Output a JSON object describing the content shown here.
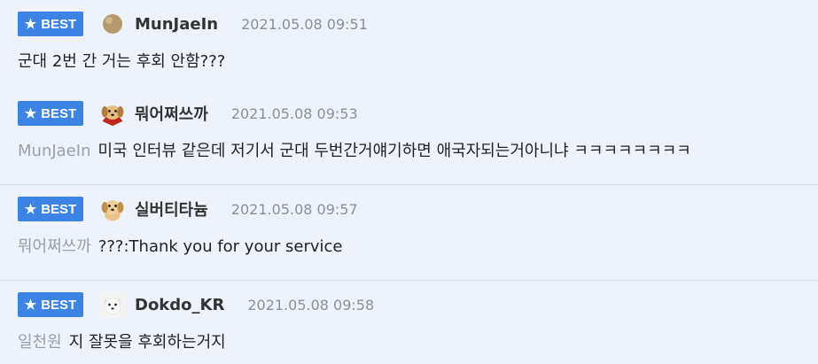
{
  "comments": [
    {
      "badge_label": "BEST",
      "avatar_kind": "round-ball-avatar",
      "author": "MunJaeIn",
      "time": "2021.05.08 09:51",
      "mention": "",
      "text": "군대 2번 간 거는 후회 안함???"
    },
    {
      "badge_label": "BEST",
      "avatar_kind": "puppy-with-cape-avatar",
      "author": "뭐어쩌쓰까",
      "time": "2021.05.08 09:53",
      "mention": "MunJaeIn",
      "text": "미국 인터뷰 같은데 저기서 군대 두번간거얘기하면 애국자되는거아니냐 ㅋㅋㅋㅋㅋㅋㅋㅋ"
    },
    {
      "badge_label": "BEST",
      "avatar_kind": "puppy-avatar",
      "author": "실버티타늄",
      "time": "2021.05.08 09:57",
      "mention": "뭐어쩌쓰까",
      "text": "???:Thank you for your service"
    },
    {
      "badge_label": "BEST",
      "avatar_kind": "white-dog-avatar",
      "author": "Dokdo_KR",
      "time": "2021.05.08 09:58",
      "mention": "일천원",
      "text": "지 잘못을 후회하는거지"
    }
  ],
  "colors": {
    "badge": "#3d83e6",
    "background": "#eef3fb",
    "mention": "#9aa0a8",
    "time": "#8a8f98"
  }
}
